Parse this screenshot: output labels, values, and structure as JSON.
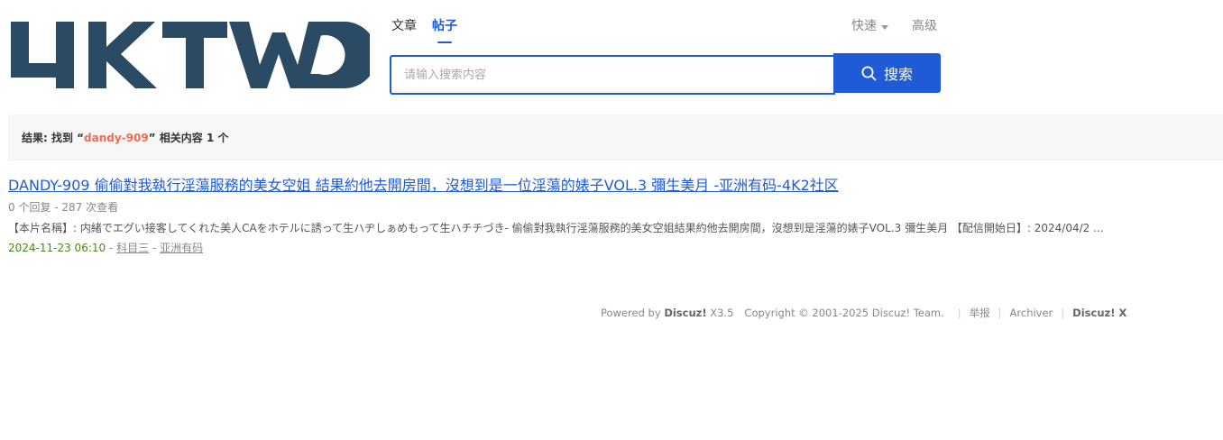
{
  "logo": {
    "alt": "4KTWO",
    "color": "#2b4a63"
  },
  "tabs": [
    {
      "label": "文章",
      "active": false
    },
    {
      "label": "帖子",
      "active": true
    }
  ],
  "quick": {
    "label": "快速",
    "advanced_label": "高级"
  },
  "search": {
    "placeholder": "请输入搜索内容",
    "value": "",
    "button_label": "搜索"
  },
  "result_summary": {
    "prefix": "结果: 找到 “",
    "keyword": "dandy-909",
    "suffix": "” 相关内容 1 个"
  },
  "results": [
    {
      "title": "DANDY-909 偷偷對我執行淫蕩服務的美女空姐 結果約他去開房間，沒想到是一位淫蕩的婊子VOL.3 彌生美月 -亚洲有码-4K2社区",
      "stats": "0 个回复 - 287 次查看",
      "summary": "【本片名稱】: 内緒でエグい接客してくれた美人CAをホテルに誘って生ハヂしぁめもって生ハチチづき- 偷偷對我執行淫蕩服務的美女空姐結果約他去開房間，沒想到是淫蕩的婊子VOL.3 彌生美月 【配信開始日】: 2024/04/2 ...",
      "date": "2024-11-23 06:10",
      "author": "科目三",
      "forum": "亚洲有码"
    }
  ],
  "footer": {
    "powered_by": "Powered by",
    "product": "Discuz!",
    "version": "X3.5",
    "copyright": "Copyright © 2001-2025 Discuz! Team.",
    "report": "举报",
    "archiver": "Archiver",
    "brand": "Discuz! X"
  },
  "colors": {
    "accent": "#1f5bd6",
    "keyword": "#f26b4f",
    "date": "#4a8a18"
  }
}
